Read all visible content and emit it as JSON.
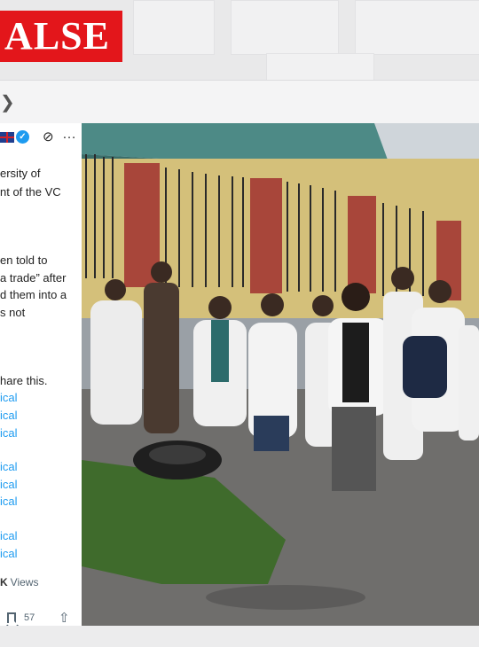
{
  "verdict": {
    "label": "ALSE",
    "color": "#e3161b"
  },
  "post": {
    "icons": {
      "flag": "uk-flag-icon",
      "verified": "verified-badge-icon",
      "grok": "grok-icon",
      "more": "more-icon"
    },
    "body_lines": [
      "ersity of",
      "nt of the VC",
      "en told to",
      "a trade” after",
      "d them into a",
      "s not",
      "hare this."
    ],
    "link_lines": [
      "ical",
      "ical",
      "ical",
      "ical",
      "ical",
      "ical",
      "ical",
      "ical"
    ],
    "views_value": "K",
    "views_label": "Views",
    "bookmark_count": "57"
  },
  "photo": {
    "description_tag": "students-in-lab-coats-protest-photo"
  }
}
